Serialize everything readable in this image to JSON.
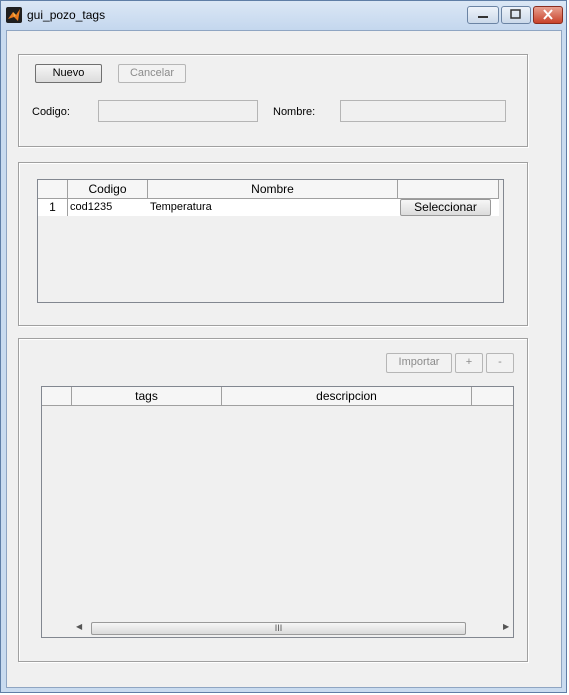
{
  "window": {
    "title": "gui_pozo_tags"
  },
  "panel1": {
    "nuevo_label": "Nuevo",
    "cancelar_label": "Cancelar",
    "codigo_label": "Codigo:",
    "nombre_label": "Nombre:",
    "codigo_value": "",
    "nombre_value": ""
  },
  "panel2": {
    "columns": [
      "Codigo",
      "Nombre",
      ""
    ],
    "rows": [
      {
        "index": "1",
        "codigo": "cod1235",
        "nombre": "Temperatura",
        "action": "Seleccionar"
      }
    ]
  },
  "panel3": {
    "importar_label": "Importar",
    "add_label": "+",
    "remove_label": "-",
    "columns": [
      "tags",
      "descripcion"
    ],
    "scroll_thumb": "III"
  }
}
